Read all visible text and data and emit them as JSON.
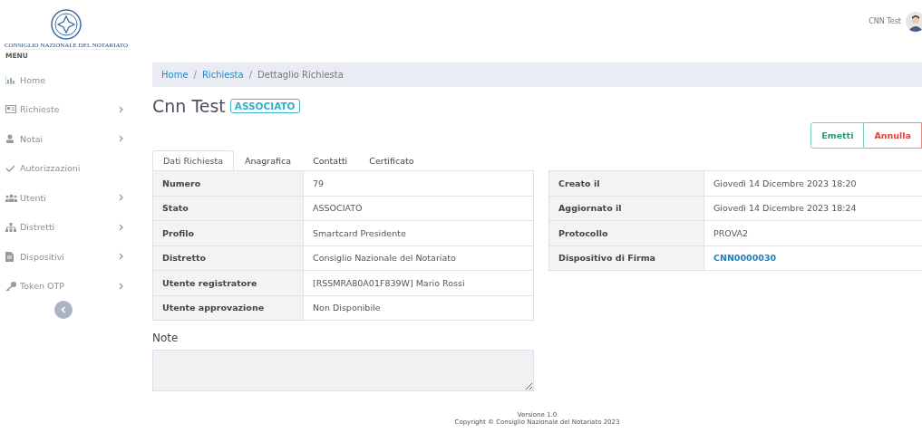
{
  "sidebar": {
    "logo_text": "CONSIGLIO NAZIONALE DEL NOTARIATO",
    "menu_label": "MENU",
    "items": [
      {
        "label": "Home",
        "expandable": false
      },
      {
        "label": "Richieste",
        "expandable": true
      },
      {
        "label": "Notai",
        "expandable": true
      },
      {
        "label": "Autorizzazioni",
        "expandable": false
      },
      {
        "label": "Utenti",
        "expandable": true
      },
      {
        "label": "Distretti",
        "expandable": true
      },
      {
        "label": "Dispositivi",
        "expandable": true
      },
      {
        "label": "Token OTP",
        "expandable": true
      }
    ]
  },
  "breadcrumb_separator": "/",
  "header": {
    "user_name": "CNN Test"
  },
  "breadcrumb": [
    {
      "label": "Home",
      "link": true
    },
    {
      "label": "Richiesta",
      "link": true
    },
    {
      "label": "Dettaglio Richiesta",
      "link": false
    }
  ],
  "title": "Cnn Test",
  "status_badge": "ASSOCIATO",
  "actions": [
    {
      "label": "Emetti",
      "kind": "success"
    },
    {
      "label": "Annulla",
      "kind": "danger"
    }
  ],
  "tabs": [
    {
      "label": "Dati Richiesta",
      "selected": true
    },
    {
      "label": "Anagrafica",
      "selected": false
    },
    {
      "label": "Contatti",
      "selected": false
    },
    {
      "label": "Certificato",
      "selected": false
    }
  ],
  "left_table": [
    {
      "label": "Numero",
      "value": "79",
      "link": false
    },
    {
      "label": "Stato",
      "value": "ASSOCIATO",
      "link": false
    },
    {
      "label": "Profilo",
      "value": "Smartcard Presidente",
      "link": false
    },
    {
      "label": "Distretto",
      "value": "Consiglio Nazionale del Notariato",
      "link": false
    },
    {
      "label": "Utente registratore",
      "value": "[RSSMRA80A01F839W] Mario Rossi",
      "link": false
    },
    {
      "label": "Utente approvazione",
      "value": "Non Disponibile",
      "link": false
    }
  ],
  "right_table": [
    {
      "label": "Creato il",
      "value": "Giovedì 14 Dicembre 2023 18:20",
      "link": false
    },
    {
      "label": "Aggiornato il",
      "value": "Giovedì 14 Dicembre 2023 18:24",
      "link": false
    },
    {
      "label": "Protocollo",
      "value": "PROVA2",
      "link": false
    },
    {
      "label": "Dispositivo di Firma",
      "value": "CNN0000030",
      "link": true
    }
  ],
  "note": {
    "label": "Note"
  },
  "footer": {
    "version": "Versione 1.0",
    "copyright": "Copyright © Consiglio Nazionale del Notariato 2023"
  }
}
